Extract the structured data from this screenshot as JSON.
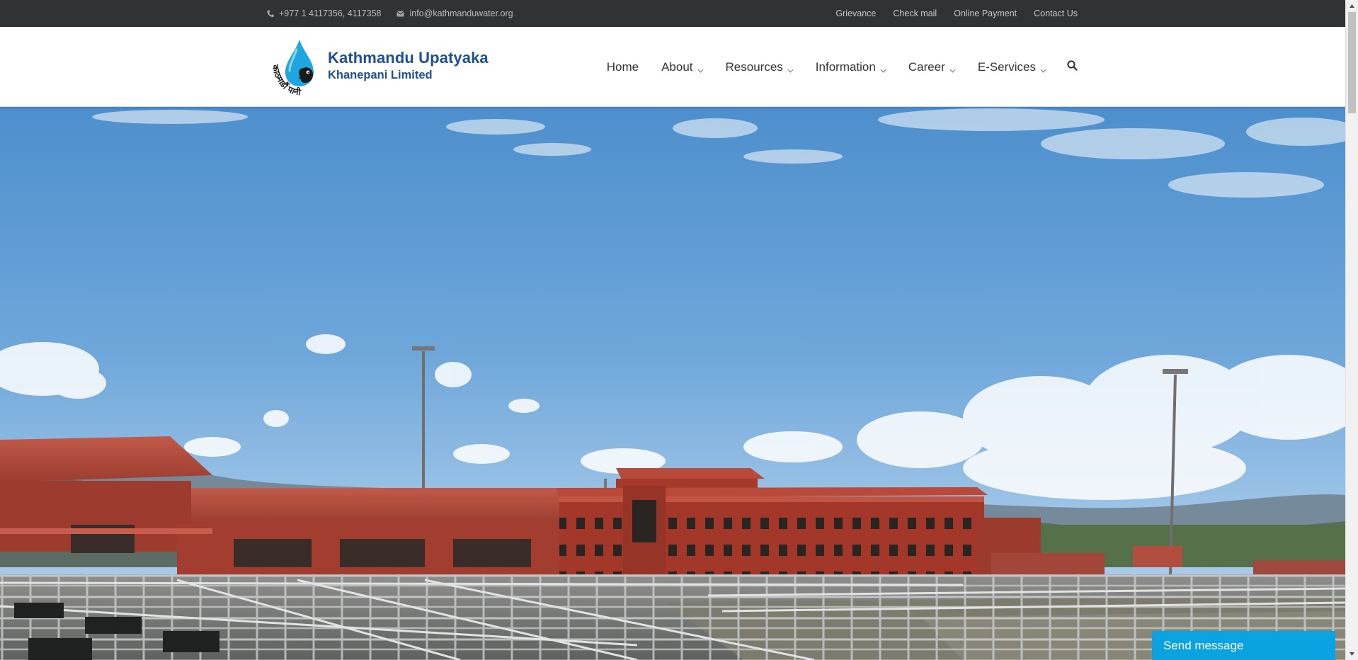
{
  "topbar": {
    "phone": "+977 1 4117356, 4117358",
    "email": "info@kathmanduwater.org",
    "links": [
      "Grievance",
      "Check mail",
      "Online Payment",
      "Contact Us"
    ]
  },
  "logo": {
    "line1": "Kathmandu Upatyaka",
    "line2": "Khanepani Limited",
    "emblem_text": "काठमाडौं पानी"
  },
  "nav": {
    "items": [
      "Home",
      "About",
      "Resources",
      "Information",
      "Career",
      "E-Services"
    ],
    "search_icon": "search-icon"
  },
  "hero": {
    "image": "water-treatment-plant-photo"
  },
  "chat": {
    "label": "Send message"
  },
  "colors": {
    "topbar_bg": "#2f3336",
    "brand_blue": "#1d4f94",
    "drop_blue": "#1fa6e0",
    "chat_bg": "#0aa2e0"
  }
}
